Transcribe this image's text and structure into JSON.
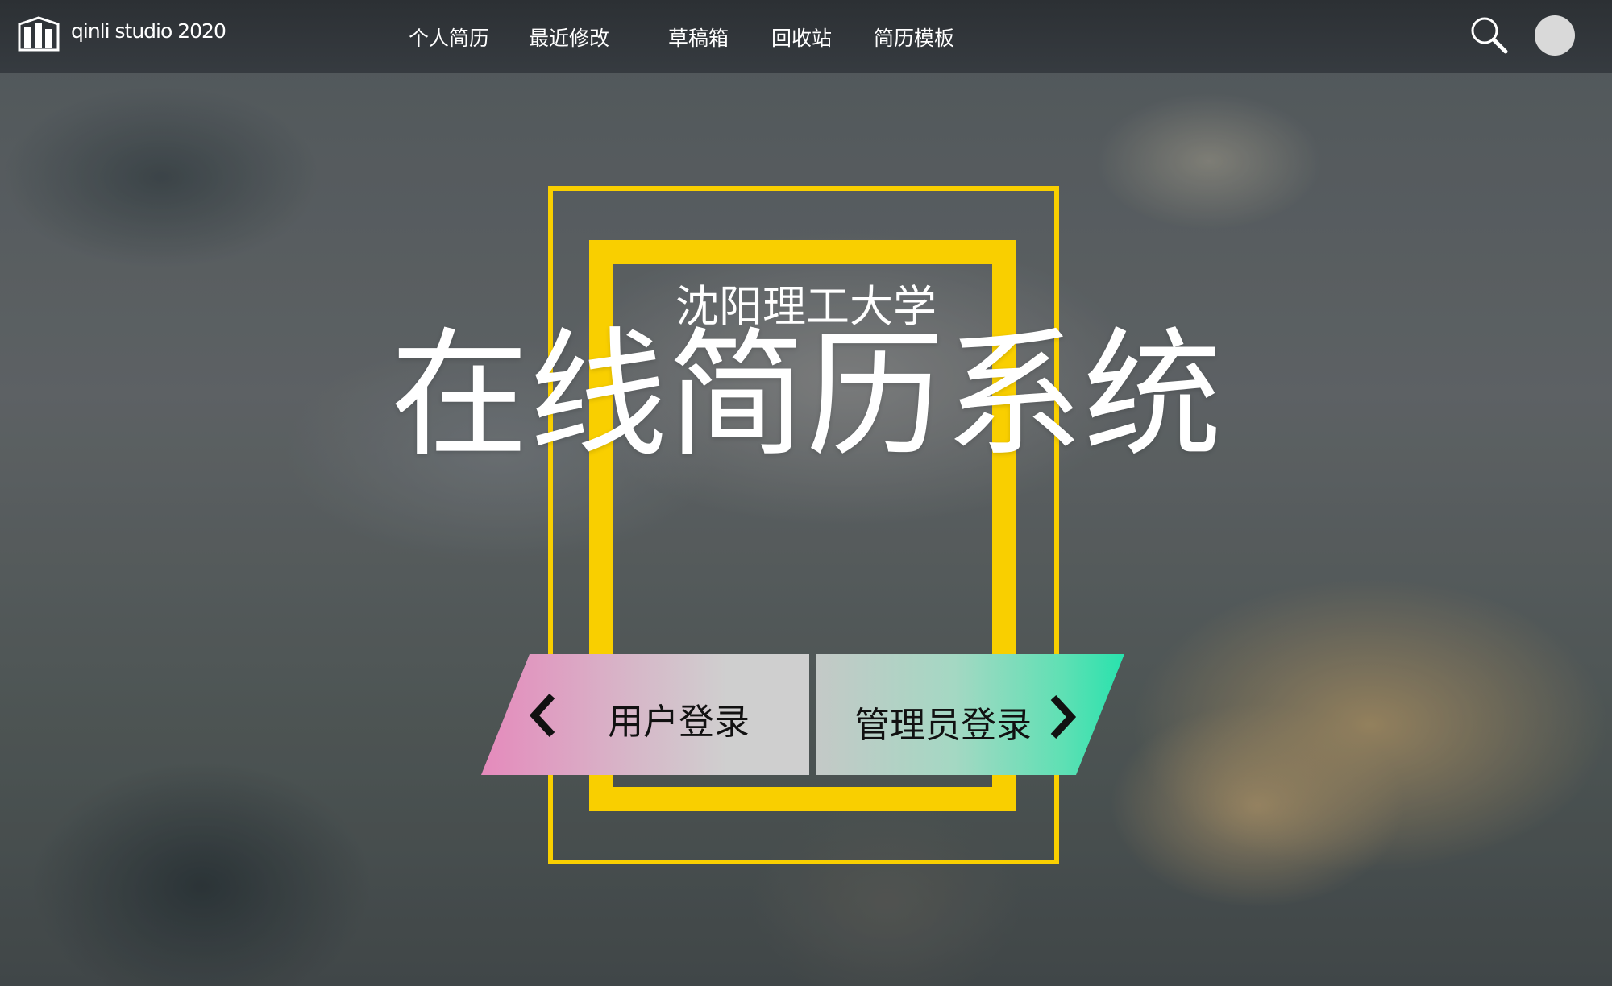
{
  "brand": {
    "logo_text": "qinli studio 2020"
  },
  "nav": {
    "items": [
      {
        "label": "个人简历"
      },
      {
        "label": "最近修改"
      },
      {
        "label": "草稿箱"
      },
      {
        "label": "回收站"
      },
      {
        "label": "简历模板"
      }
    ]
  },
  "hero": {
    "subtitle": "沈阳理工大学",
    "title": "在线简历系统"
  },
  "buttons": {
    "user_login": "用户登录",
    "admin_login": "管理员登录"
  },
  "colors": {
    "frame": "#f9cf00",
    "navbar": "#2c3034",
    "user_gradient_start": "#e58abc",
    "admin_gradient_end": "#28e2ad"
  },
  "icons": [
    "logo-icon",
    "search-icon",
    "avatar",
    "chevron-left-icon",
    "chevron-right-icon"
  ]
}
